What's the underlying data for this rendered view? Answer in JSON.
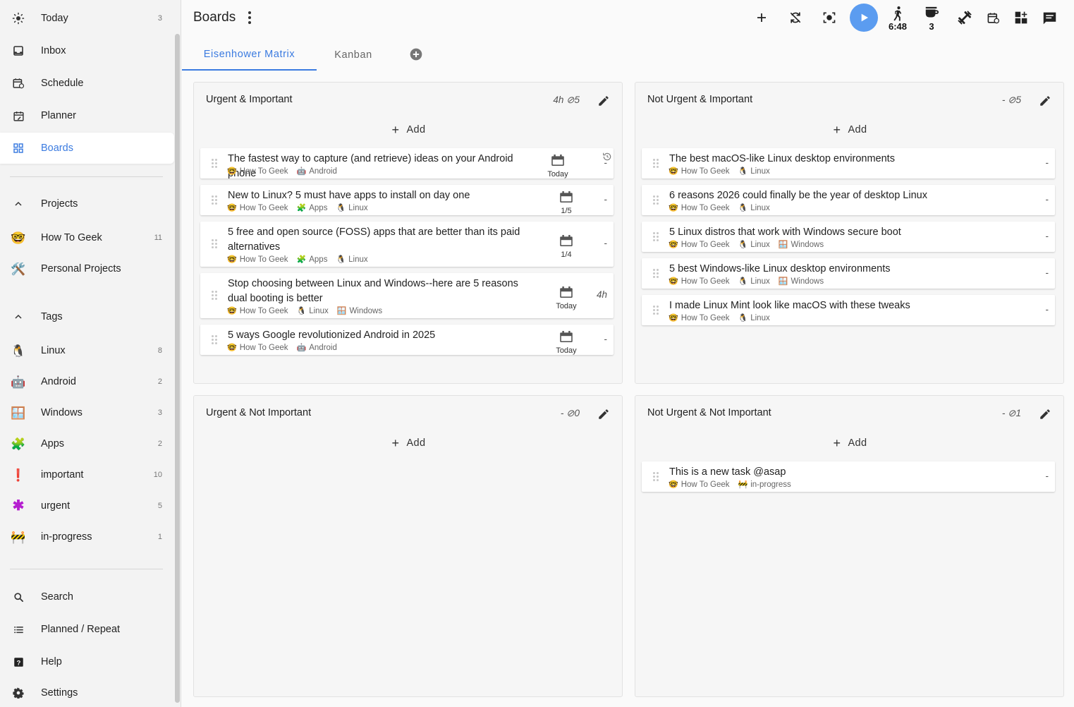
{
  "sidebar": {
    "nav": [
      {
        "label": "Today",
        "count": "3",
        "icon": "sun-icon"
      },
      {
        "label": "Inbox",
        "count": "",
        "icon": "inbox-icon"
      },
      {
        "label": "Schedule",
        "count": "",
        "icon": "schedule-icon"
      },
      {
        "label": "Planner",
        "count": "",
        "icon": "planner-icon"
      },
      {
        "label": "Boards",
        "count": "",
        "icon": "boards-icon"
      }
    ],
    "projects_header": "Projects",
    "projects": [
      {
        "label": "How To Geek",
        "count": "11",
        "emoji": "🤓"
      },
      {
        "label": "Personal Projects",
        "count": "",
        "emoji": "🛠️"
      }
    ],
    "tags_header": "Tags",
    "tags": [
      {
        "label": "Linux",
        "count": "8",
        "emoji": "🐧"
      },
      {
        "label": "Android",
        "count": "2",
        "emoji": "🤖"
      },
      {
        "label": "Windows",
        "count": "3",
        "emoji": "🪟"
      },
      {
        "label": "Apps",
        "count": "2",
        "emoji": "🧩"
      },
      {
        "label": "important",
        "count": "10",
        "emoji": "❗"
      },
      {
        "label": "urgent",
        "count": "5",
        "emoji": "✱"
      },
      {
        "label": "in-progress",
        "count": "1",
        "emoji": "🚧"
      }
    ],
    "bottom": [
      {
        "label": "Search",
        "icon": "search-icon"
      },
      {
        "label": "Planned / Repeat",
        "icon": "list-icon"
      },
      {
        "label": "Help",
        "icon": "help-icon"
      },
      {
        "label": "Settings",
        "icon": "gear-icon"
      }
    ]
  },
  "header": {
    "title": "Boards",
    "walk_time": "6:48",
    "coffee_count": "3"
  },
  "tabs": [
    "Eisenhower Matrix",
    "Kanban"
  ],
  "add_label": "Add",
  "accent": "#3b7be0",
  "boards": [
    {
      "title": "Urgent & Important",
      "meta": "4h ⊘5",
      "tasks": [
        {
          "title": "The fastest way to capture (and retrieve) ideas on your Android phone",
          "tags": [
            [
              "🤓",
              "How To Geek"
            ],
            [
              "🤖",
              "Android"
            ]
          ],
          "due": "Today",
          "time": "-",
          "repeat": true
        },
        {
          "title": "New to Linux? 5 must have apps to install on day one",
          "tags": [
            [
              "🤓",
              "How To Geek"
            ],
            [
              "🧩",
              "Apps"
            ],
            [
              "🐧",
              "Linux"
            ]
          ],
          "due": "1/5",
          "time": "-"
        },
        {
          "title": "5 free and open source (FOSS) apps that are better than its paid alternatives",
          "tags": [
            [
              "🤓",
              "How To Geek"
            ],
            [
              "🧩",
              "Apps"
            ],
            [
              "🐧",
              "Linux"
            ]
          ],
          "due": "1/4",
          "time": "-"
        },
        {
          "title": "Stop choosing between Linux and Windows--here are 5 reasons dual booting is better",
          "tags": [
            [
              "🤓",
              "How To Geek"
            ],
            [
              "🐧",
              "Linux"
            ],
            [
              "🪟",
              "Windows"
            ]
          ],
          "due": "Today",
          "time": "4h"
        },
        {
          "title": "5 ways Google revolutionized Android in 2025",
          "tags": [
            [
              "🤓",
              "How To Geek"
            ],
            [
              "🤖",
              "Android"
            ]
          ],
          "due": "Today",
          "time": "-"
        }
      ]
    },
    {
      "title": "Not Urgent & Important",
      "meta": "- ⊘5",
      "tasks": [
        {
          "title": "The best macOS-like Linux desktop environments",
          "tags": [
            [
              "🤓",
              "How To Geek"
            ],
            [
              "🐧",
              "Linux"
            ]
          ],
          "time": "-"
        },
        {
          "title": "6 reasons 2026 could finally be the year of desktop Linux",
          "tags": [
            [
              "🤓",
              "How To Geek"
            ],
            [
              "🐧",
              "Linux"
            ]
          ],
          "time": "-"
        },
        {
          "title": "5 Linux distros that work with Windows secure boot",
          "tags": [
            [
              "🤓",
              "How To Geek"
            ],
            [
              "🐧",
              "Linux"
            ],
            [
              "🪟",
              "Windows"
            ]
          ],
          "time": "-"
        },
        {
          "title": "5 best Windows-like Linux desktop environments",
          "tags": [
            [
              "🤓",
              "How To Geek"
            ],
            [
              "🐧",
              "Linux"
            ],
            [
              "🪟",
              "Windows"
            ]
          ],
          "time": "-"
        },
        {
          "title": "I made Linux Mint look like macOS with these tweaks",
          "tags": [
            [
              "🤓",
              "How To Geek"
            ],
            [
              "🐧",
              "Linux"
            ]
          ],
          "time": "-"
        }
      ]
    },
    {
      "title": "Urgent & Not Important",
      "meta": "- ⊘0",
      "tasks": []
    },
    {
      "title": "Not Urgent & Not Important",
      "meta": "- ⊘1",
      "tasks": [
        {
          "title": "This is a new task @asap",
          "tags": [
            [
              "🤓",
              "How To Geek"
            ],
            [
              "🚧",
              "in-progress"
            ]
          ],
          "time": "-"
        }
      ]
    }
  ]
}
